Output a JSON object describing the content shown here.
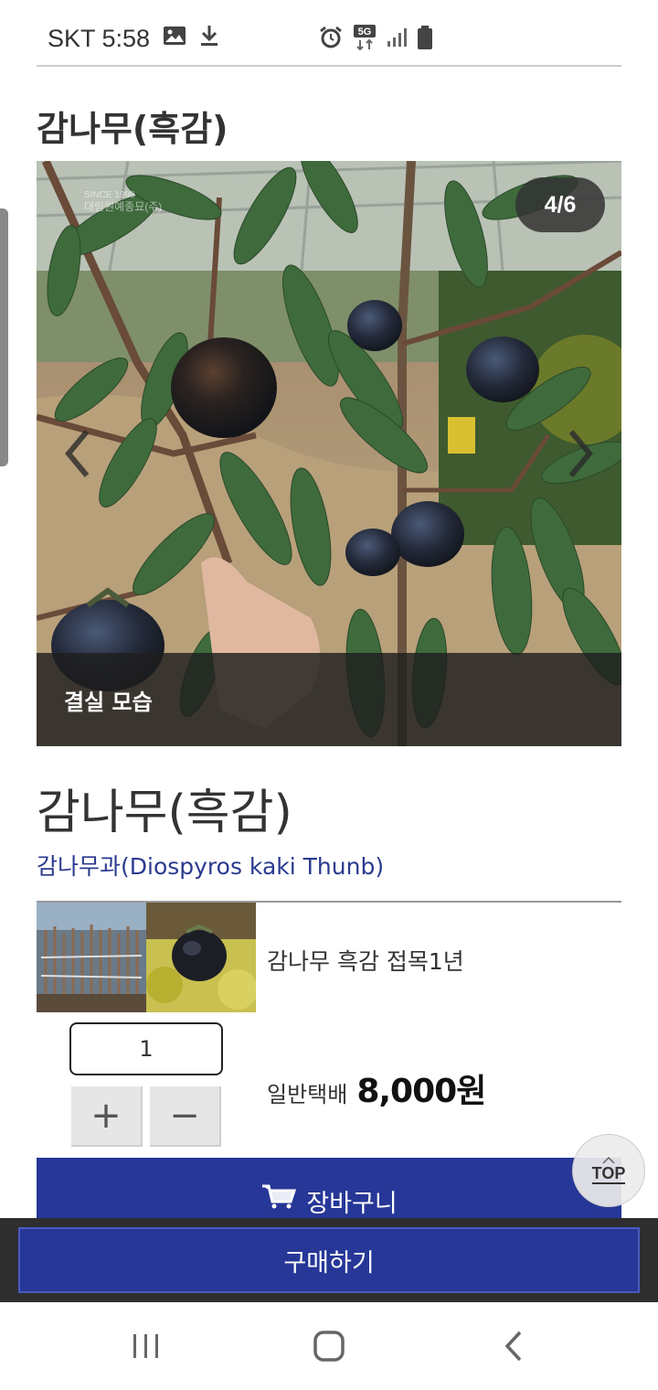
{
  "status_bar": {
    "carrier_time": "SKT 5:58",
    "icons": [
      "image-icon",
      "download-icon",
      "alarm-icon",
      "5g-icon",
      "signal-icon",
      "battery-icon"
    ]
  },
  "page": {
    "title": "감나무(흑감)"
  },
  "carousel": {
    "counter": "4/6",
    "caption": "결실 모습",
    "watermark_lines": [
      "SINCE 1998",
      "대림원예종묘(주)"
    ]
  },
  "product": {
    "name": "감나무(흑감)",
    "scientific": "감나무과(Diospyros kaki Thunb)"
  },
  "option": {
    "name": "감나무 흑감 접목1년",
    "quantity": "1",
    "plus_label": "+",
    "minus_label": "−",
    "shipping_label": "일반택배",
    "price": "8,000원"
  },
  "actions": {
    "cart_label": "장바구니",
    "buy_label": "구매하기",
    "top_label": "TOP"
  },
  "colors": {
    "primary": "#263797",
    "scientific_text": "#2a3a8f"
  }
}
